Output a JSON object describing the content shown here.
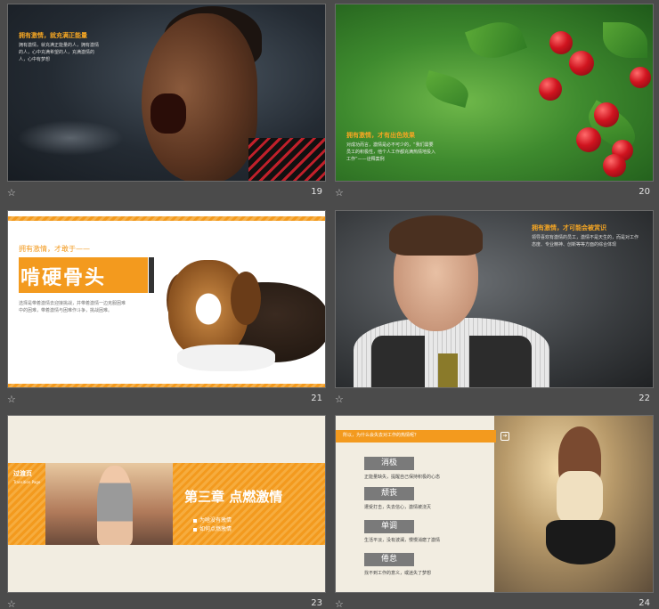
{
  "slides": [
    {
      "number": "19",
      "title": "拥有激情，就充满正能量",
      "body": "拥有激情，就充满正能量的人，拥有激情的人，心中充满希望的人，充满激情的人，心中有梦想"
    },
    {
      "number": "20",
      "title": "拥有激情，才有出色效果",
      "body": "对成功而言，激情是必不可少的，“我们需要员工的积极性，他个人工作都充满热情地投入工作”——诠释案例"
    },
    {
      "number": "21",
      "subtitle": "拥有激情，才敢于——",
      "title": "啃硬骨头",
      "body": "选择是带着激情去迎接挑战，并带着激情一边克服困难中的困难，带着激情与困难作斗争，挑战困难。"
    },
    {
      "number": "22",
      "title": "拥有激情，才可能会被赏识",
      "body": "领导喜欢有激情的员工，激情不是天生的，而是对工作态度、专业精神、创新等等方面的综合体现"
    },
    {
      "number": "23",
      "tag": "过渡页",
      "tag_sub": "Transition Page",
      "title": "第三章 点燃激情",
      "items": [
        "为啥没有激情",
        "如何点燃激情"
      ]
    },
    {
      "number": "24",
      "header": "所以，为什么会失去对工作的热情呢？",
      "items": [
        {
          "label": "消极",
          "desc": "正能量缺失，提醒自己保持积极的心态"
        },
        {
          "label": "颓丧",
          "desc": "遭受打击，失去信心，激情被浇灭"
        },
        {
          "label": "单调",
          "desc": "生活平淡，没有波澜，慢慢消磨了激情"
        },
        {
          "label": "倦怠",
          "desc": "找不到工作的意义，或迷失了梦想"
        }
      ]
    }
  ],
  "star_icon": "☆",
  "colors": {
    "accent": "#f39a1e",
    "bg": "#4b4b4b"
  }
}
